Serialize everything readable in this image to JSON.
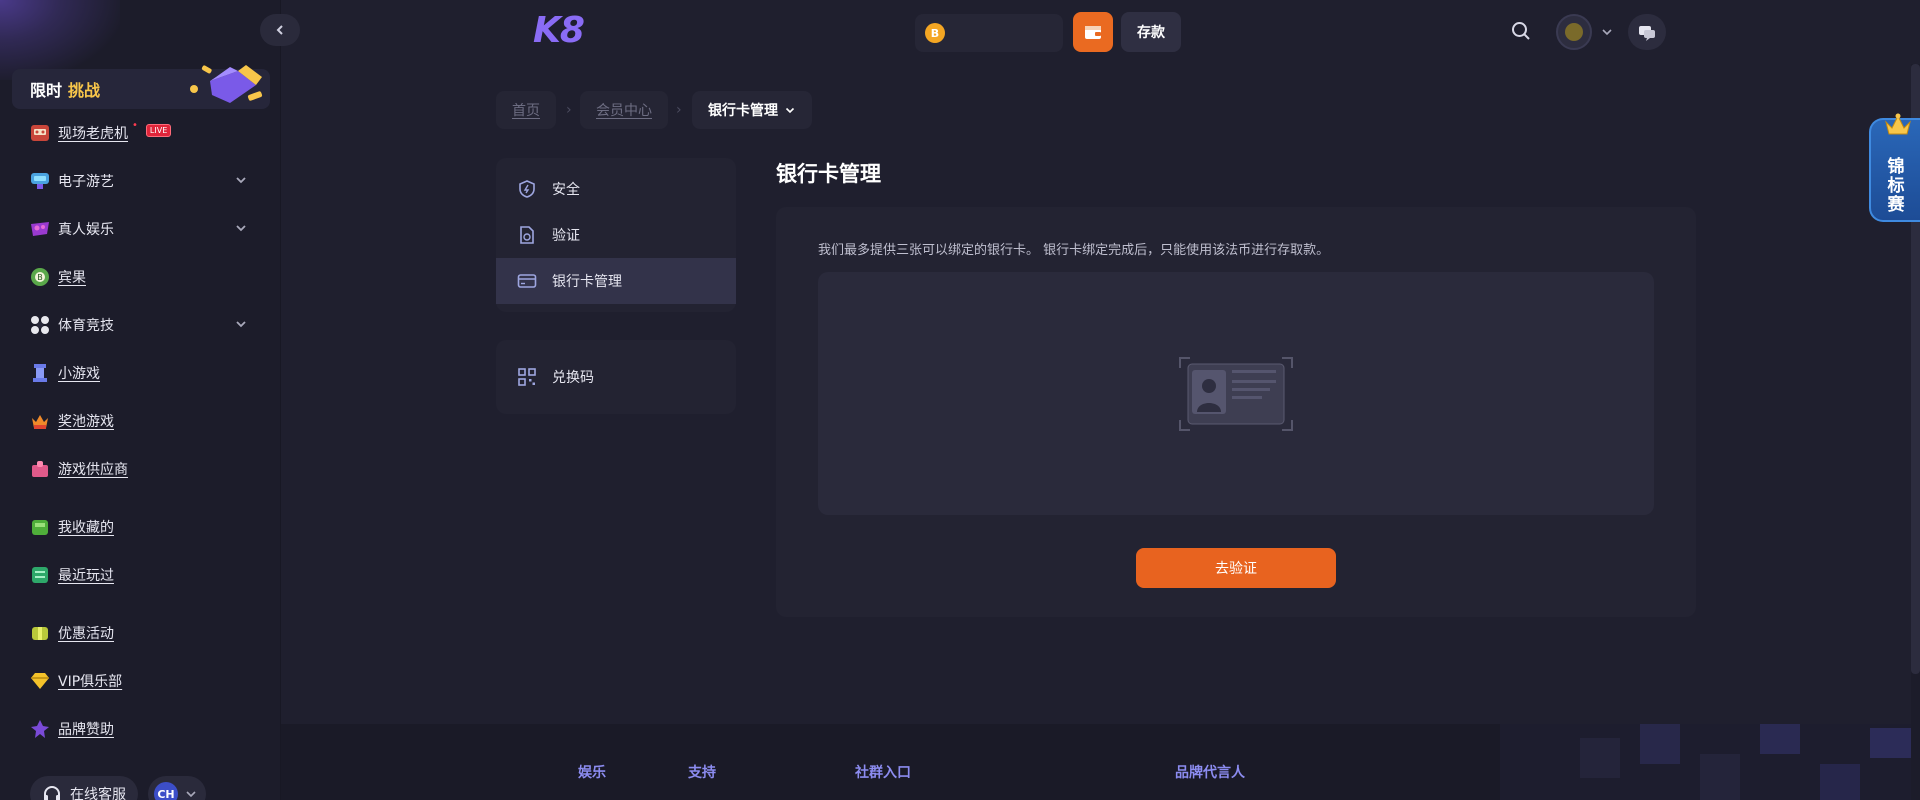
{
  "sidebar": {
    "challenge": {
      "word1": "限时",
      "word2": "挑战"
    },
    "items": [
      {
        "label": "现场老虎机",
        "icon": "slot-machine-icon",
        "badge": "LIVE",
        "expandable": false
      },
      {
        "label": "电子游艺",
        "icon": "arcade-icon",
        "expandable": true
      },
      {
        "label": "真人娱乐",
        "icon": "live-casino-icon",
        "expandable": true
      },
      {
        "label": "宾果",
        "icon": "bingo-icon",
        "expandable": false
      },
      {
        "label": "体育竞技",
        "icon": "soccer-ball-icon",
        "expandable": true
      },
      {
        "label": "小游戏",
        "icon": "mini-game-icon",
        "expandable": false
      },
      {
        "label": "奖池游戏",
        "icon": "jackpot-icon",
        "expandable": false
      },
      {
        "label": "游戏供应商",
        "icon": "provider-icon",
        "expandable": false
      },
      {
        "label": "我收藏的",
        "icon": "favorites-icon",
        "expandable": false
      },
      {
        "label": "最近玩过",
        "icon": "recent-icon",
        "expandable": false
      },
      {
        "label": "优惠活动",
        "icon": "promotion-icon",
        "expandable": false
      },
      {
        "label": "VIP俱乐部",
        "icon": "vip-diamond-icon",
        "expandable": false
      },
      {
        "label": "品牌赞助",
        "icon": "sponsor-icon",
        "expandable": false
      }
    ],
    "support_label": "在线客服",
    "language_code": "CH"
  },
  "header": {
    "logo": "K8",
    "coin_symbol": "B",
    "deposit_label": "存款"
  },
  "breadcrumb": {
    "home": "首页",
    "member_center": "会员中心",
    "current": "银行卡管理"
  },
  "account_menu": {
    "items": [
      {
        "label": "安全",
        "icon": "shield-icon"
      },
      {
        "label": "验证",
        "icon": "verify-document-icon"
      },
      {
        "label": "银行卡管理",
        "icon": "bank-card-icon",
        "active": true
      }
    ],
    "redeem": {
      "label": "兑换码",
      "icon": "qr-code-icon"
    }
  },
  "main": {
    "title": "银行卡管理",
    "notice": "我们最多提供三张可以绑定的银行卡。 银行卡绑定完成后，只能使用该法币进行存取款。",
    "verify_button": "去验证"
  },
  "footer": {
    "columns": [
      "娱乐",
      "支持",
      "社群入口",
      "品牌代言人"
    ]
  },
  "side_tab": {
    "label": "锦标赛"
  },
  "colors": {
    "accent_orange": "#e8631f",
    "logo_purple": "#8a6cf5",
    "challenge_gold": "#f8c64a",
    "side_tab_blue": "#2a67b8"
  }
}
